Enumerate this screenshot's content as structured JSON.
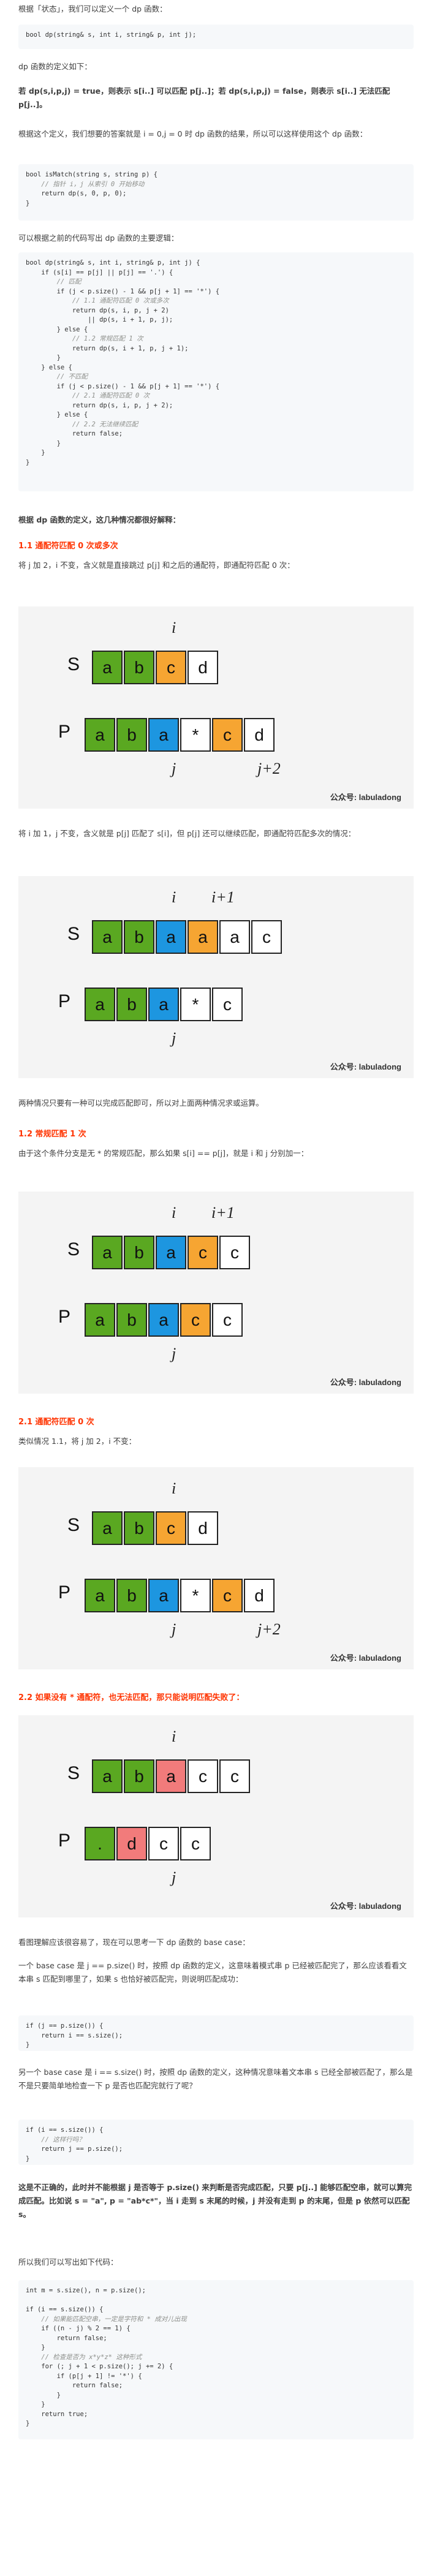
{
  "intro": {
    "line1": "根据「状态」，我们可以定义一个 dp 函数：",
    "code_sig": "bool dp(string& s, int i, string& p, int j);",
    "line2": "dp 函数的定义如下：",
    "line3": "若 dp(s,i,p,j) = true，则表示 s[i..] 可以匹配 p[j..]；若 dp(s,i,p,j) = false，则表示 s[i..] 无法匹配 p[j..]。",
    "line4": "根据这个定义，我们想要的答案就是 i = 0,j = 0 时 dp 函数的结果，所以可以这样使用这个 dp 函数：",
    "line5": "可以根据之前的代码写出 dp 函数的主要逻辑：",
    "line6": "根据 dp 函数的定义，这几种情况都很好解释："
  },
  "code_ismatch": [
    "bool isMatch(string s, string p) {",
    "    // 指针 i，j 从索引 0 开始移动",
    "    return dp(s, 0, p, 0);",
    "}"
  ],
  "code_main": [
    "bool dp(string& s, int i, string& p, int j) {",
    "    if (s[i] == p[j] || p[j] == '.') {",
    "        // 匹配",
    "        if (j < p.size() - 1 && p[j + 1] == '*') {",
    "            // 1.1 通配符匹配 0 次或多次",
    "            return dp(s, i, p, j + 2)",
    "                || dp(s, i + 1, p, j);",
    "        } else {",
    "            // 1.2 常规匹配 1 次",
    "            return dp(s, i + 1, p, j + 1);",
    "        }",
    "    } else {",
    "        // 不匹配",
    "        if (j < p.size() - 1 && p[j + 1] == '*') {",
    "            // 2.1 通配符匹配 0 次",
    "            return dp(s, i, p, j + 2);",
    "        } else {",
    "            // 2.2 无法继续匹配",
    "            return false;",
    "        }",
    "    }",
    "}"
  ],
  "h11": "1.1 通配符匹配 0 次或多次",
  "p11": "将 j 加 2，i 不变，含义就是直接跳过 p[j] 和之后的通配符，即通配符匹配 0 次：",
  "p11b": "将 i 加 1，j 不变，含义就是 p[j] 匹配了 s[i]，但 p[j] 还可以继续匹配，即通配符匹配多次的情况：",
  "p11c": "两种情况只要有一种可以完成匹配即可，所以对上面两种情况求或运算。",
  "h12": "1.2 常规匹配 1 次",
  "p12": "由于这个条件分支是无 * 的常规匹配，那么如果 s[i] == p[j]，就是 i 和 j 分别加一：",
  "h21": "2.1 通配符匹配 0 次",
  "p21": "类似情况 1.1，将 j 加 2，i 不变：",
  "h22": "2.2 如果没有 * 通配符，也无法匹配，那只能说明匹配失败了：",
  "p_base1": "看图理解应该很容易了，现在可以思考一下 dp 函数的 base case：",
  "p_base2": "一个 base case 是 j == p.size() 时，按照 dp 函数的定义，这意味着模式串 p 已经被匹配完了，那么应该看看文本串 s 匹配到哪里了，如果 s 也恰好被匹配完，则说明匹配成功：",
  "code_base1": [
    "if (j == p.size()) {",
    "    return i == s.size();",
    "}"
  ],
  "p_base3": "另一个 base case 是 i == s.size() 时，按照 dp 函数的定义，这种情况意味着文本串 s 已经全部被匹配了，那么是不是只要简单地检查一下 p 是否也匹配完就行了呢？",
  "code_base2": [
    "if (i == s.size()) {",
    "    // 这样行吗？",
    "    return j == p.size();",
    "}"
  ],
  "p_base4": "这是不正确的，此时并不能根据 j 是否等于 p.size() 来判断是否完成匹配，只要 p[j..] 能够匹配空串，就可以算完成匹配。比如说 s = \"a\", p = \"ab*c*\"，当 i 走到 s 末尾的时候，j 并没有走到 p 的末尾，但是 p 依然可以匹配 s。",
  "p_base5": "所以我们可以写出如下代码：",
  "code_final": [
    "int m = s.size(), n = p.size();",
    "",
    "if (i == s.size()) {",
    "    // 如果能匹配空串，一定是字符和 * 成对儿出现",
    "    if ((n - j) % 2 == 1) {",
    "        return false;",
    "    }",
    "    // 检查是否为 x*y*z* 这种形式",
    "    for (; j + 1 < p.size(); j += 2) {",
    "        if (p[j + 1] != '*') {",
    "            return false;",
    "        }",
    "    }",
    "    return true;",
    "}"
  ],
  "figures": {
    "watermark": "公众号: labuladong",
    "fig1": {
      "s": [
        "a",
        "b",
        "c",
        "d"
      ],
      "p": [
        "a",
        "b",
        "a",
        "*",
        "c",
        "d"
      ],
      "marks": [
        "i",
        "j",
        "j+2"
      ]
    },
    "fig2": {
      "s": [
        "a",
        "b",
        "a",
        "a",
        "a",
        "c"
      ],
      "p": [
        "a",
        "b",
        "a",
        "*",
        "c"
      ],
      "marks": [
        "i",
        "i+1",
        "j"
      ]
    },
    "fig3": {
      "s": [
        "a",
        "b",
        "a",
        "c",
        "c"
      ],
      "p": [
        "a",
        "b",
        "a",
        "c",
        "c"
      ],
      "marks": [
        "i",
        "i+1",
        "j"
      ]
    },
    "fig4": {
      "s": [
        "a",
        "b",
        "c",
        "d"
      ],
      "p": [
        "a",
        "b",
        "a",
        "*",
        "c",
        "d"
      ],
      "marks": [
        "i",
        "j",
        "j+2"
      ]
    },
    "fig5": {
      "s": [
        "a",
        "b",
        "a",
        "c",
        "c"
      ],
      "p": [
        ".",
        "d",
        "c",
        "c"
      ],
      "marks": [
        "i",
        "j"
      ]
    },
    "row_labels": [
      "S",
      "P"
    ]
  },
  "colors": {
    "green": "#5aa821",
    "blue": "#1d96e0",
    "orange": "#f6a532",
    "pink": "#f27b7b",
    "accent": "#ff3300"
  }
}
